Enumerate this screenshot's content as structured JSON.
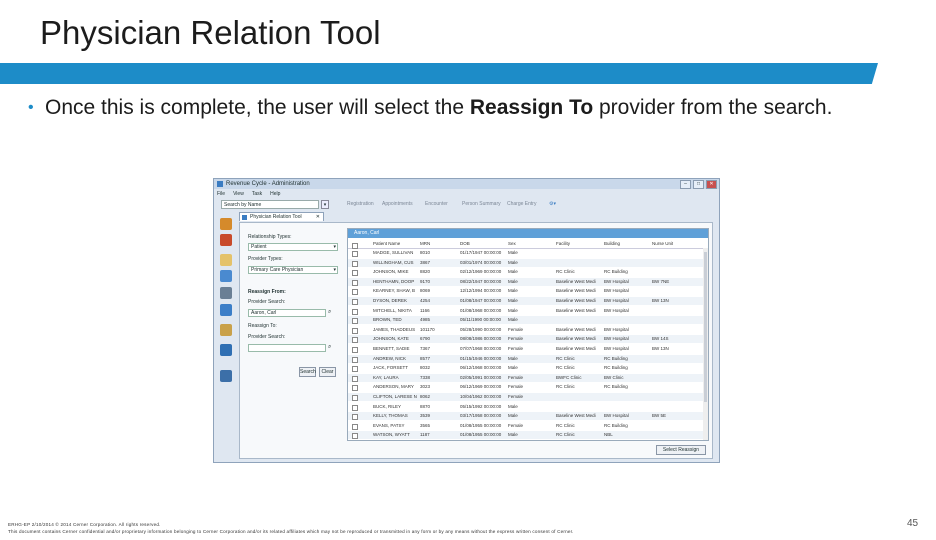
{
  "slide": {
    "title": "Physician Relation Tool",
    "bullet_before": "Once this is complete, the user will select the ",
    "bullet_bold": "Reassign To",
    "bullet_after": " provider from the search.",
    "page_number": "45",
    "footer_line1": "ERHG-EP 2/10/2014  © 2014 Cerner Corporation. All rights reserved.",
    "footer_line2": "This document contains Cerner confidential and/or proprietary information belonging to Cerner Corporation and/or its related affiliates which may not be reproduced or transmitted in any form or by any means without the express written consent of Cerner."
  },
  "colors": {
    "accent": "#1d8cc8",
    "grid_header": "#5fa0d8"
  },
  "app": {
    "window_title": "Revenue Cycle - Administration",
    "menu": [
      "File",
      "View",
      "Task",
      "Help"
    ],
    "search_placeholder": "Search by Name",
    "toolbar": [
      "Registration",
      "Appointments",
      "Encounter",
      "Person Summary",
      "Charge Entry"
    ],
    "tab_label": "Physician Relation Tool",
    "form": {
      "relationship_types_label": "Relationship Types:",
      "relationship_type_value": "Patient",
      "provider_types_label": "Provider Types:",
      "provider_type_value": "Primary Care Physician",
      "reassign_from_label": "Reassign From:",
      "provider_search_label": "Provider Search:",
      "provider_search_value": "Aaron, Carl",
      "reassign_to_label": "Reassign To:",
      "provider_search2_label": "Provider Search:",
      "search_button": "Search",
      "clear_button": "Clear"
    },
    "grid": {
      "header": "Aaron, Carl",
      "columns": [
        "Patient Name",
        "MRN",
        "DOB",
        "Sex",
        "Facility",
        "Building",
        "Nurse Unit"
      ],
      "rows": [
        [
          "MADGE, SULLIVAN",
          "8010",
          "01/17/1947 00:00:00",
          "Male",
          "",
          "",
          ""
        ],
        [
          "WILLINGHAM, CUS",
          "3867",
          "03/01/1974 00:00:00",
          "Male",
          "",
          "",
          ""
        ],
        [
          "JOHNSON, MIKE",
          "8820",
          "02/12/1969 00:00:00",
          "Male",
          "RC Clinic",
          "RC Building",
          ""
        ],
        [
          "HENTHAMN, DOOP",
          "9170",
          "08/22/1947 00:00:00",
          "Male",
          "Baseline West Medi",
          "BW Hospital",
          "BW 7NE"
        ],
        [
          "KEARNEY, SHAW, B",
          "8069",
          "12/12/1994 00:00:00",
          "Male",
          "Baseline West Medi",
          "BW Hospital",
          ""
        ],
        [
          "DYSON, DEREK",
          "4254",
          "01/08/1947 00:00:00",
          "Male",
          "Baseline West Medi",
          "BW Hospital",
          "BW 13N"
        ],
        [
          "MITCHELL, NIKITA",
          "1166",
          "01/08/1968 00:00:00",
          "Male",
          "Baseline West Medi",
          "BW Hospital",
          ""
        ],
        [
          "BROWN, TED",
          "4985",
          "05/11/1990 00:00:00",
          "Male",
          "",
          "",
          ""
        ],
        [
          "JAMES, THADDEUS",
          "101170",
          "05/28/1990 00:00:00",
          "Female",
          "Baseline West Medi",
          "BW Hospital",
          ""
        ],
        [
          "JOHNSON, KATE",
          "6790",
          "08/08/1986 00:00:00",
          "Female",
          "Baseline West Medi",
          "BW Hospital",
          "BW 14S"
        ],
        [
          "BENNETT, SADIE",
          "7367",
          "07/07/1968 00:00:00",
          "Female",
          "Baseline West Medi",
          "BW Hospital",
          "BW 13N"
        ],
        [
          "ANDREW, NICK",
          "8577",
          "01/15/1946 00:00:00",
          "Male",
          "RC Clinic",
          "RC Building",
          ""
        ],
        [
          "JACK, FORSETT",
          "8032",
          "06/12/1968 00:00:00",
          "Male",
          "RC Clinic",
          "RC Building",
          ""
        ],
        [
          "KAY, LAURA",
          "7338",
          "02/05/1991 00:00:00",
          "Female",
          "BWFC Clinic",
          "BW Clinic",
          ""
        ],
        [
          "ANDERSON, MARY",
          "3023",
          "06/12/1969 00:00:00",
          "Female",
          "RC Clinic",
          "RC Building",
          ""
        ],
        [
          "CLIFTON, LARESE N",
          "8062",
          "10/04/1962 00:00:00",
          "Female",
          "",
          "",
          ""
        ],
        [
          "BUCK, RILEY",
          "8870",
          "05/15/1992 00:00:00",
          "Male",
          "",
          "",
          ""
        ],
        [
          "KELLY, THOMAS",
          "3539",
          "03/17/1958 00:00:00",
          "Male",
          "Baseline West Medi",
          "BW Hospital",
          "BW 5E"
        ],
        [
          "EVANS, PATSY",
          "3565",
          "01/08/1955 00:00:00",
          "Female",
          "RC Clinic",
          "RC Building",
          ""
        ],
        [
          "WATSON, WYATT",
          "1187",
          "01/08/1955 00:00:00",
          "Male",
          "RC Clinic",
          "NBL",
          ""
        ]
      ],
      "select_button": "Select Reassign"
    }
  }
}
